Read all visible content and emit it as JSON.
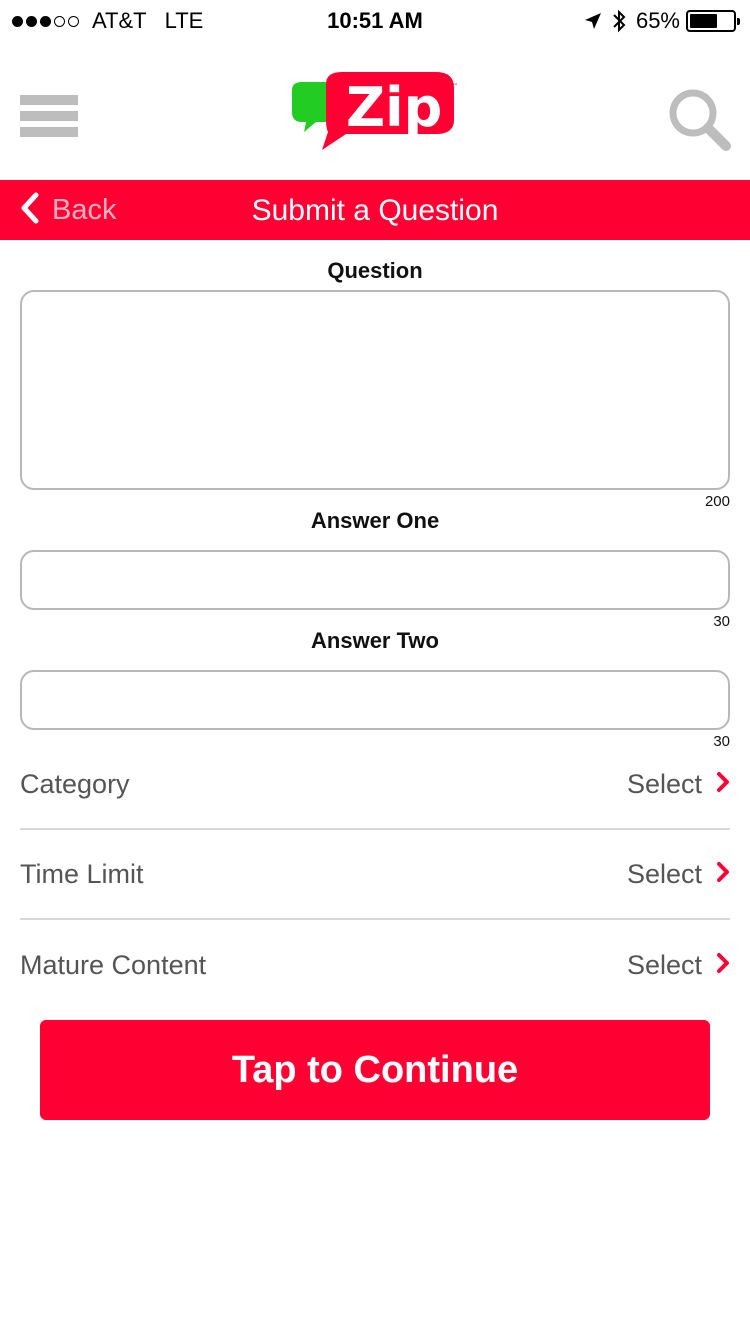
{
  "status_bar": {
    "carrier": "AT&T",
    "network": "LTE",
    "time": "10:51 AM",
    "battery": "65%",
    "battery_level": 0.65,
    "signal_bars_filled": 3,
    "signal_bars_total": 5
  },
  "header": {
    "logo_text": "Zip",
    "brand_colors": {
      "red": "#ff0033",
      "green": "#22cc22"
    }
  },
  "title_bar": {
    "back_label": "Back",
    "title": "Submit a Question"
  },
  "form": {
    "question": {
      "label": "Question",
      "value": "",
      "counter": "200"
    },
    "answer_one": {
      "label": "Answer One",
      "value": "",
      "counter": "30"
    },
    "answer_two": {
      "label": "Answer Two",
      "value": "",
      "counter": "30"
    },
    "options": [
      {
        "label": "Category",
        "value": "Select"
      },
      {
        "label": "Time Limit",
        "value": "Select"
      },
      {
        "label": "Mature Content",
        "value": "Select"
      }
    ],
    "continue_label": "Tap to Continue"
  },
  "colors": {
    "accent": "#ff0033",
    "muted_text": "#555555",
    "divider": "#d8d8d8"
  }
}
